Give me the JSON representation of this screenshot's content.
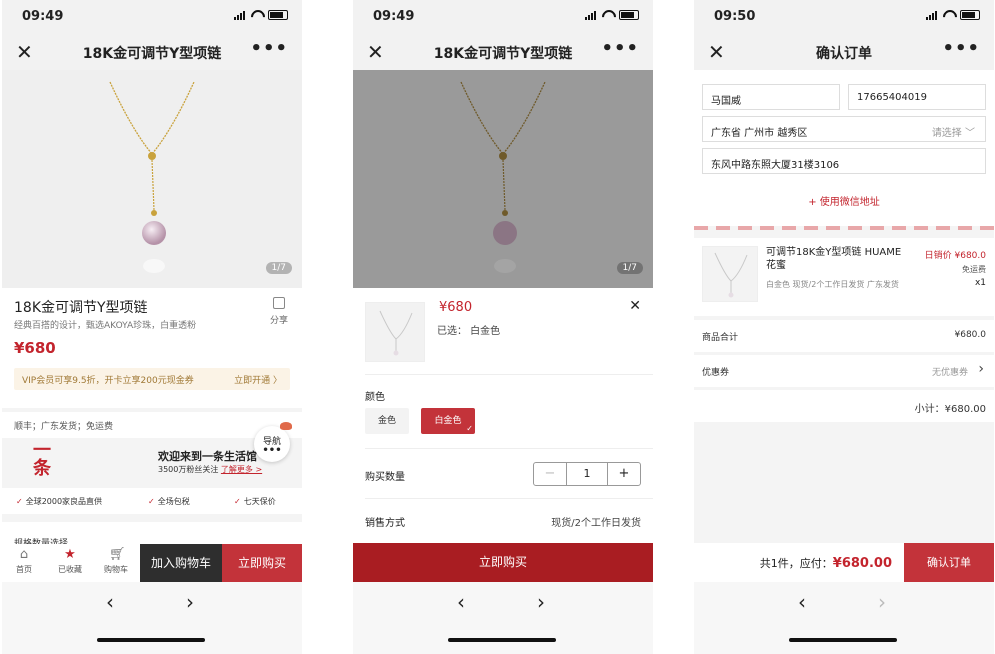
{
  "screen1": {
    "status_time": "09:49",
    "title": "18K金可调节Y型项链",
    "pager": "1/7",
    "product_name": "18K金可调节Y型项链",
    "subtitle": "经典百搭的设计，甄选AKOYA珍珠，白重透粉",
    "share_label": "分享",
    "price": "¥680",
    "vip_text": "VIP会员可享9.5折，开卡立享200元现金券",
    "vip_open": "立即开通 〉",
    "shipping": "顺丰；广东发货；免运费",
    "brand_logo": "一 条",
    "welcome": "欢迎来到一条生活馆",
    "fans_text": "3500万粉丝关注",
    "fans_link": "了解更多 >",
    "guide_label": "导航",
    "guide_dots": "•••",
    "benefits": [
      "全球2000家良品直供",
      "全场包税",
      "七天保价"
    ],
    "cut_text": "规格数量选择",
    "tabs": [
      {
        "label": "首页",
        "icon": "home-icon"
      },
      {
        "label": "已收藏",
        "icon": "star-icon"
      },
      {
        "label": "购物车",
        "icon": "cart-icon"
      }
    ],
    "add_to_cart": "加入购物车",
    "buy_now": "立即购买"
  },
  "screen2": {
    "status_time": "09:49",
    "title": "18K金可调节Y型项链",
    "pager": "1/7",
    "price": "¥680",
    "chosen": "已选：   白金色",
    "color_label": "颜色",
    "colors": [
      "金色",
      "白金色"
    ],
    "selected_color": "白金色",
    "qty_label": "购买数量",
    "qty": "1",
    "minus": "−",
    "plus": "+",
    "method_label": "销售方式",
    "method_value": "现货/2个工作日发货",
    "buy_now": "立即购买"
  },
  "screen3": {
    "status_time": "09:50",
    "title": "确认订单",
    "name": "马国威",
    "phone": "17665404019",
    "region": "广东省 广州市 越秀区",
    "region_placeholder": "请选择 ﹀",
    "street": "东风中路东照大厦31楼3106",
    "use_wechat": "+ 使用微信地址",
    "item_name": "可调节18K金Y型项链 HUAME 花蜜",
    "item_meta": "白金色  现货/2个工作日发货  广东发货",
    "item_price": "日销价 ¥680.0",
    "item_free": "免运费",
    "item_qty": "x1",
    "subtotal_label": "商品合计",
    "subtotal_value": "¥680.0",
    "coupon_label": "优惠券",
    "coupon_value": "无优惠券",
    "small_total": "小计：¥680.00",
    "pay_text_prefix": "共1件，应付：",
    "pay_amount": "¥680.00",
    "confirm": "确认订单"
  },
  "colors": {
    "accent": "#c3333a",
    "dark_button": "#2e2e2e",
    "price_red": "#c3242d"
  }
}
